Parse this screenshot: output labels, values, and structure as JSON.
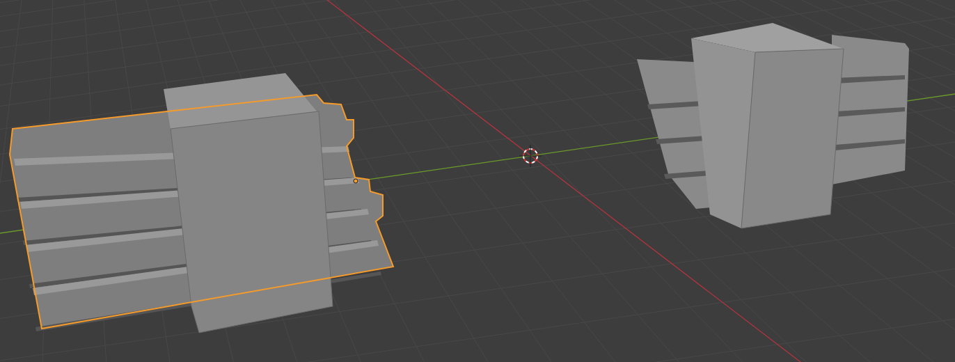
{
  "viewport": {
    "objects": [
      {
        "selected": true
      },
      {
        "selected": false
      }
    ]
  }
}
